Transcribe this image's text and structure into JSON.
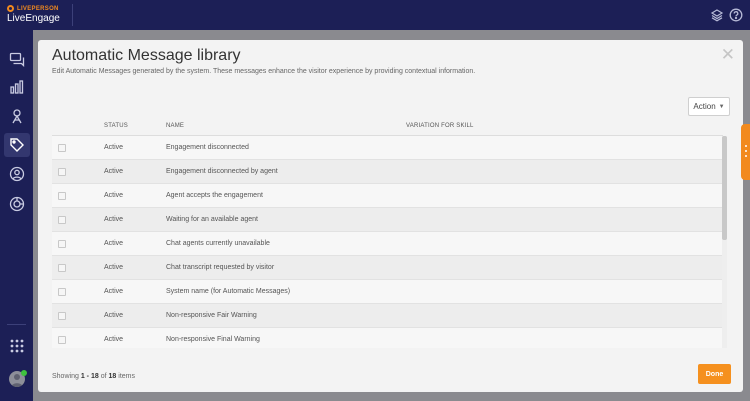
{
  "brand": {
    "small": "LIVEPERSON",
    "name": "LiveEngage"
  },
  "header": {
    "icons": [
      "layers-icon",
      "help-icon"
    ]
  },
  "sidebar": {
    "items": [
      {
        "name": "chat-icon",
        "active": false
      },
      {
        "name": "analytics-icon",
        "active": false
      },
      {
        "name": "campaigns-icon",
        "active": false
      },
      {
        "name": "tag-icon",
        "active": true
      },
      {
        "name": "users-icon",
        "active": false
      },
      {
        "name": "automation-icon",
        "active": false
      }
    ],
    "bottom": [
      "apps-grid-icon",
      "avatar-icon"
    ]
  },
  "modal": {
    "title": "Automatic Message library",
    "subtitle": "Edit Automatic Messages generated by the system. These messages enhance the visitor experience by providing contextual information.",
    "action_label": "Action",
    "columns": {
      "status": "STATUS",
      "name": "NAME",
      "variation": "VARIATION FOR SKILL"
    },
    "rows": [
      {
        "status": "Active",
        "name": "Engagement disconnected",
        "variation": ""
      },
      {
        "status": "Active",
        "name": "Engagement disconnected by agent",
        "variation": ""
      },
      {
        "status": "Active",
        "name": "Agent accepts the engagement",
        "variation": ""
      },
      {
        "status": "Active",
        "name": "Waiting for an available agent",
        "variation": ""
      },
      {
        "status": "Active",
        "name": "Chat agents currently unavailable",
        "variation": ""
      },
      {
        "status": "Active",
        "name": "Chat transcript requested by visitor",
        "variation": ""
      },
      {
        "status": "Active",
        "name": "System name (for Automatic Messages)",
        "variation": ""
      },
      {
        "status": "Active",
        "name": "Non-responsive Fair Warning",
        "variation": ""
      },
      {
        "status": "Active",
        "name": "Non-responsive Final Warning",
        "variation": ""
      }
    ],
    "footer": {
      "showing": "Showing",
      "from": "1",
      "dash": "-",
      "to": "18",
      "of": "of",
      "total": "18",
      "items": "items"
    },
    "done_label": "Done"
  },
  "colors": {
    "accent": "#f5901e",
    "nav_bg": "#1c1f56"
  }
}
